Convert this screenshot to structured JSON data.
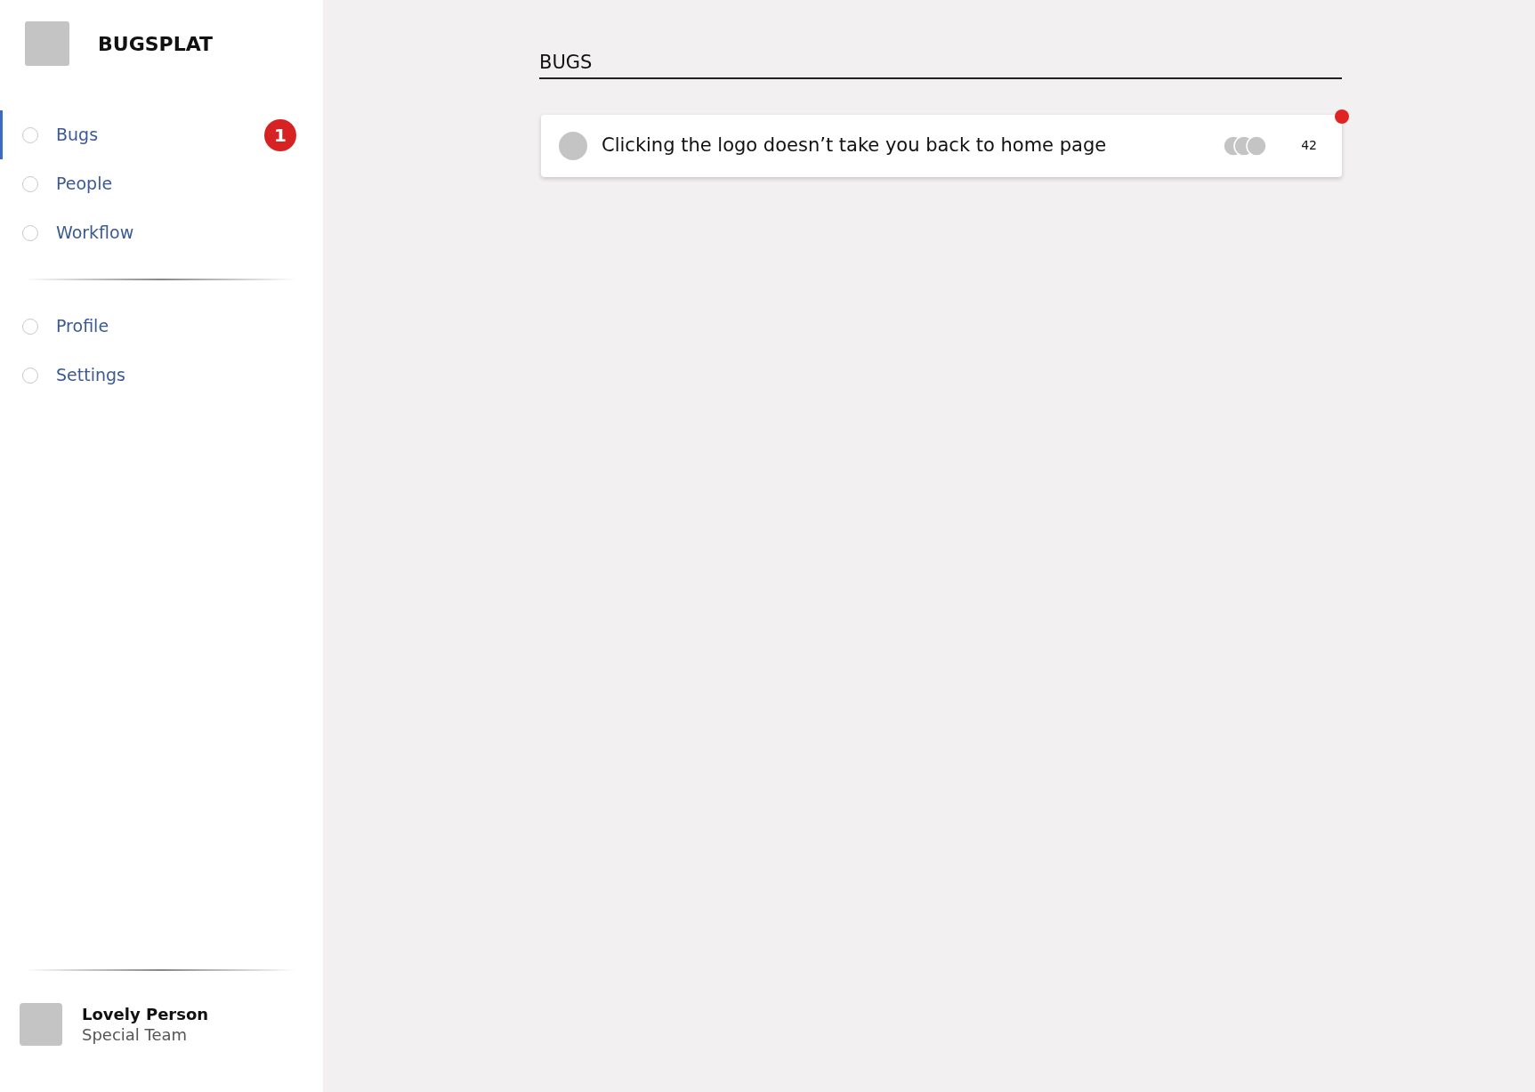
{
  "app": {
    "name": "BUGSPLAT"
  },
  "sidebar": {
    "groups": [
      {
        "items": [
          {
            "label": "Bugs",
            "selected": true,
            "badge": "1"
          },
          {
            "label": "People",
            "selected": false
          },
          {
            "label": "Workflow",
            "selected": false
          }
        ]
      },
      {
        "items": [
          {
            "label": "Profile",
            "selected": false
          },
          {
            "label": "Settings",
            "selected": false
          }
        ]
      }
    ]
  },
  "user": {
    "name": "Lovely Person",
    "team": "Special Team"
  },
  "main": {
    "title": "BUGS",
    "bugs": [
      {
        "title": "Clicking the logo doesn’t take you back to home page",
        "count": "42",
        "unread": true
      }
    ]
  }
}
